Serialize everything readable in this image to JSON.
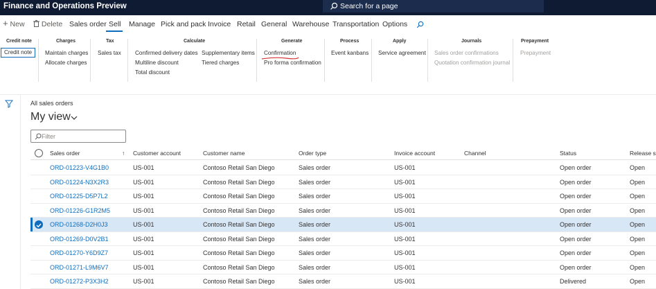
{
  "app": {
    "title": "Finance and Operations Preview",
    "search_placeholder": "Search for a page"
  },
  "actions": {
    "new": "New",
    "delete": "Delete",
    "tabs": [
      "Sales order",
      "Manage",
      "Sell",
      "Pick and pack",
      "Invoice",
      "Retail",
      "General",
      "Warehouse",
      "Transportation",
      "Options"
    ],
    "active_tab": "Sell"
  },
  "ribbon": {
    "credit_note": {
      "header": "Credit note",
      "item": "Credit note"
    },
    "charges": {
      "header": "Charges",
      "items": [
        "Maintain charges",
        "Allocate charges"
      ]
    },
    "tax": {
      "header": "Tax",
      "items": [
        "Sales tax"
      ]
    },
    "calculate": {
      "header": "Calculate",
      "items": [
        "Confirmed delivery dates",
        "Multiline discount",
        "Total discount",
        "Supplementary items",
        "Tiered charges"
      ]
    },
    "generate": {
      "header": "Generate",
      "items": [
        "Confirmation",
        "Pro forma confirmation"
      ]
    },
    "process": {
      "header": "Process",
      "items": [
        "Event kanbans"
      ]
    },
    "apply": {
      "header": "Apply",
      "items": [
        "Service agreement"
      ]
    },
    "journals": {
      "header": "Journals",
      "items": [
        "Sales order confirmations",
        "Quotation confirmation journal"
      ]
    },
    "prepayment": {
      "header": "Prepayment",
      "items": [
        "Prepayment"
      ]
    },
    "annotation_color": "#d13438"
  },
  "page": {
    "breadcrumb": "All sales orders",
    "view_title": "My view",
    "filter_placeholder": "Filter"
  },
  "grid": {
    "columns": [
      "Sales order",
      "Customer account",
      "Customer name",
      "Order type",
      "Invoice account",
      "Channel",
      "Status",
      "Release sta"
    ],
    "sort_indicator": "↑",
    "rows": [
      {
        "id": "ORD-01223-V4G1B0",
        "acct": "US-001",
        "name": "Contoso Retail San Diego",
        "type": "Sales order",
        "inv": "US-001",
        "channel": "",
        "status": "Open order",
        "release": "Open"
      },
      {
        "id": "ORD-01224-N3X2R3",
        "acct": "US-001",
        "name": "Contoso Retail San Diego",
        "type": "Sales order",
        "inv": "US-001",
        "channel": "",
        "status": "Open order",
        "release": "Open"
      },
      {
        "id": "ORD-01225-D5P7L2",
        "acct": "US-001",
        "name": "Contoso Retail San Diego",
        "type": "Sales order",
        "inv": "US-001",
        "channel": "",
        "status": "Open order",
        "release": "Open"
      },
      {
        "id": "ORD-01226-G1R2M5",
        "acct": "US-001",
        "name": "Contoso Retail San Diego",
        "type": "Sales order",
        "inv": "US-001",
        "channel": "",
        "status": "Open order",
        "release": "Open"
      },
      {
        "id": "ORD-01268-D2H0J3",
        "acct": "US-001",
        "name": "Contoso Retail San Diego",
        "type": "Sales order",
        "inv": "US-001",
        "channel": "",
        "status": "Open order",
        "release": "Open",
        "selected": true
      },
      {
        "id": "ORD-01269-D0V2B1",
        "acct": "US-001",
        "name": "Contoso Retail San Diego",
        "type": "Sales order",
        "inv": "US-001",
        "channel": "",
        "status": "Open order",
        "release": "Open"
      },
      {
        "id": "ORD-01270-Y6D9Z7",
        "acct": "US-001",
        "name": "Contoso Retail San Diego",
        "type": "Sales order",
        "inv": "US-001",
        "channel": "",
        "status": "Open order",
        "release": "Open"
      },
      {
        "id": "ORD-01271-L9M6V7",
        "acct": "US-001",
        "name": "Contoso Retail San Diego",
        "type": "Sales order",
        "inv": "US-001",
        "channel": "",
        "status": "Open order",
        "release": "Open"
      },
      {
        "id": "ORD-01272-P3X3H2",
        "acct": "US-001",
        "name": "Contoso Retail San Diego",
        "type": "Sales order",
        "inv": "US-001",
        "channel": "",
        "status": "Delivered",
        "release": "Open"
      }
    ]
  }
}
